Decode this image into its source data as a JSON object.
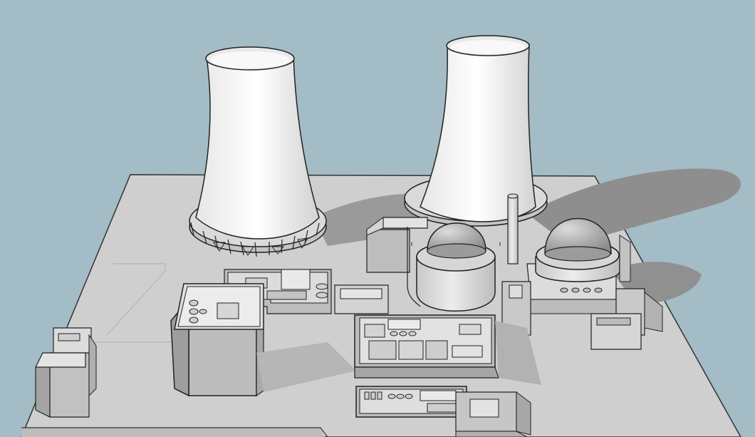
{
  "scene": {
    "colors": {
      "sky": "#a3bcc6",
      "ground": "#cfcfcf",
      "shadow": "#8e8e8e",
      "tower": "#f4f4f4",
      "tower_shade": "#d9d9d9",
      "building_light": "#e3e3e3",
      "building_mid": "#bdbdbd",
      "building_dark": "#9f9f9f",
      "line": "#2a2a2a"
    }
  }
}
